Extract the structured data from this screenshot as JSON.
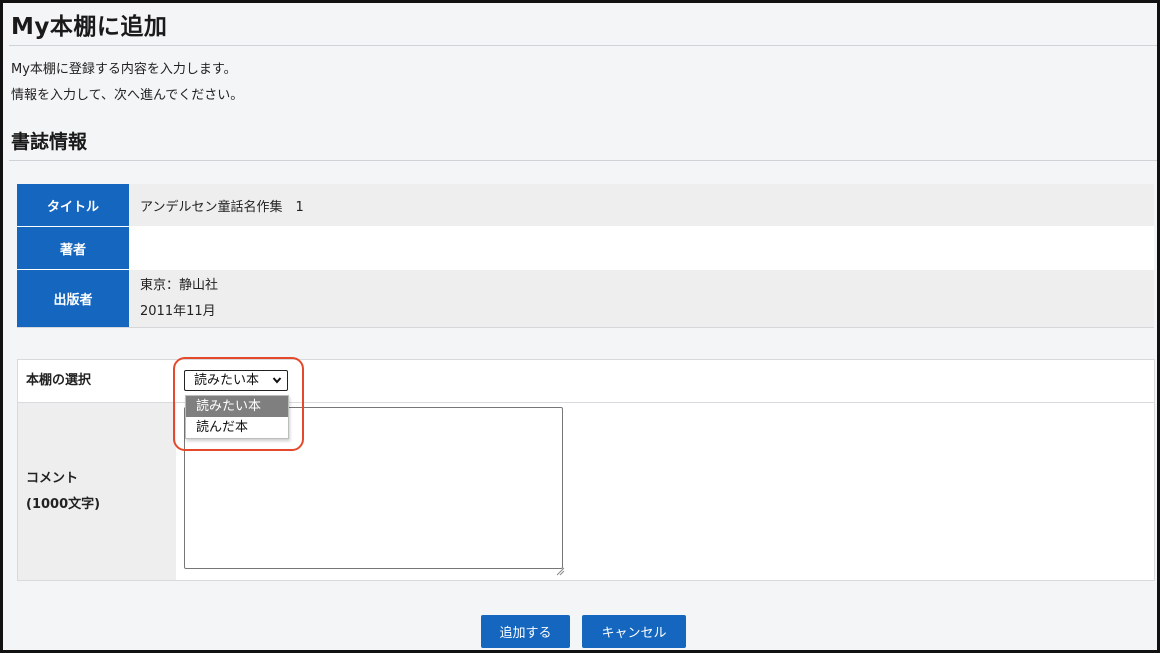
{
  "page": {
    "title": "My本棚に追加",
    "intro_line1": "My本棚に登録する内容を入力します。",
    "intro_line2": "情報を入力して、次へ進んでください。"
  },
  "bibliographic": {
    "section_title": "書誌情報",
    "rows": [
      {
        "label": "タイトル",
        "lines": [
          "アンデルセン童話名作集　1"
        ]
      },
      {
        "label": "著者",
        "lines": []
      },
      {
        "label": "出版者",
        "lines": [
          "東京：静山社",
          "2011年11月"
        ]
      }
    ]
  },
  "form": {
    "shelf_label": "本棚の選択",
    "shelf_selected": "読みたい本",
    "shelf_options": [
      "読みたい本",
      "読んだ本"
    ],
    "comment_label_line1": "コメント",
    "comment_label_line2": "(1000文字)",
    "comment_value": ""
  },
  "buttons": {
    "add_label": "追加する",
    "cancel_label": "キャンセル"
  },
  "icons": {
    "select_arrow": "chevron-down-icon"
  },
  "colors": {
    "header_blue": "#1466bf",
    "highlight": "#e4492b"
  }
}
